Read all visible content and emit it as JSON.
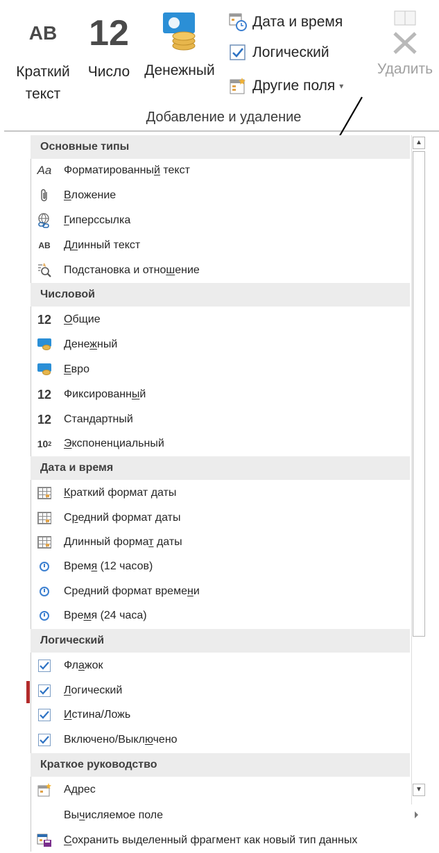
{
  "ribbon": {
    "short_text": {
      "icon_text": "AB",
      "label_line1": "Краткий",
      "label_line2": "текст"
    },
    "number": {
      "icon_text": "12",
      "label": "Число"
    },
    "currency": {
      "label": "Денежный"
    },
    "date_time": {
      "label": "Дата и время"
    },
    "logical": {
      "label": "Логический"
    },
    "more_fields": {
      "label": "Другие поля"
    },
    "delete": {
      "label": "Удалить"
    },
    "group_title": "Добавление и удаление"
  },
  "menu": {
    "sections": [
      {
        "title": "Основные типы"
      },
      {
        "title": "Числовой"
      },
      {
        "title": "Дата и время"
      },
      {
        "title": "Логический"
      },
      {
        "title": "Краткое руководство"
      }
    ],
    "basic": [
      {
        "icon": "formatted-text-icon",
        "icon_text": "Aa",
        "label_pre": "Форматированны",
        "label_u": "й",
        "label_post": " текст"
      },
      {
        "icon": "paperclip-icon",
        "label_pre": "",
        "label_u": "В",
        "label_post": "ложение"
      },
      {
        "icon": "hyperlink-icon",
        "label_pre": "",
        "label_u": "Г",
        "label_post": "иперссылка"
      },
      {
        "icon": "long-text-icon",
        "icon_text": "AB",
        "label_pre": "Д",
        "label_u": "л",
        "label_post": "инный текст"
      },
      {
        "icon": "lookup-icon",
        "label_pre": "Подстановка и отно",
        "label_u": "ш",
        "label_post": "ение"
      }
    ],
    "numeric": [
      {
        "icon": "number-icon",
        "icon_text": "12",
        "label_pre": "",
        "label_u": "О",
        "label_post": "бщие"
      },
      {
        "icon": "currency-icon",
        "label_pre": "Дене",
        "label_u": "ж",
        "label_post": "ный"
      },
      {
        "icon": "euro-icon",
        "label_pre": "",
        "label_u": "Е",
        "label_post": "вро"
      },
      {
        "icon": "number-icon",
        "icon_text": "12",
        "label_pre": "Фиксированн",
        "label_u": "ы",
        "label_post": "й"
      },
      {
        "icon": "number-icon",
        "icon_text": "12",
        "label_pre": "Стан",
        "label_u": "д",
        "label_post": "артный"
      },
      {
        "icon": "scientific-icon",
        "icon_text": "10",
        "icon_sup": "2",
        "label_pre": "",
        "label_u": "Э",
        "label_post": "кспоненциальный"
      }
    ],
    "datetime": [
      {
        "icon": "calendar-icon",
        "label_pre": "",
        "label_u": "К",
        "label_post": "раткий формат даты"
      },
      {
        "icon": "calendar-icon",
        "label_pre": "С",
        "label_u": "р",
        "label_post": "едний формат даты"
      },
      {
        "icon": "calendar-icon",
        "label_pre": "Длинный форма",
        "label_u": "т",
        "label_post": " даты"
      },
      {
        "icon": "clock-icon",
        "label_pre": "Врем",
        "label_u": "я",
        "label_post": " (12 часов)"
      },
      {
        "icon": "clock-icon",
        "label_pre": "Средний формат време",
        "label_u": "н",
        "label_post": "и"
      },
      {
        "icon": "clock-icon",
        "label_pre": "Вре",
        "label_u": "м",
        "label_post": "я (24 часа)"
      }
    ],
    "logical": [
      {
        "icon": "checkbox-icon",
        "label_pre": "Фл",
        "label_u": "а",
        "label_post": "жок"
      },
      {
        "icon": "checkbox-icon",
        "label_pre": "",
        "label_u": "Л",
        "label_post": "огический"
      },
      {
        "icon": "checkbox-icon",
        "label_pre": "",
        "label_u": "И",
        "label_post": "стина/Ложь"
      },
      {
        "icon": "checkbox-icon",
        "label_pre": "Включено/Выкл",
        "label_u": "ю",
        "label_post": "чено"
      }
    ],
    "quickstart": [
      {
        "icon": "address-icon",
        "label_pre": "Адрес",
        "label_u": "",
        "label_post": ""
      }
    ],
    "footer": {
      "calculated": {
        "label_pre": "Вы",
        "label_u": "ч",
        "label_post": "исляемое поле"
      },
      "save_as": {
        "label_pre": "",
        "label_u": "С",
        "label_post": "охранить выделенный фрагмент как новый тип данных"
      }
    }
  },
  "colors": {
    "accent_blue": "#2b8fd6",
    "coin_gold": "#e7b64c",
    "section_bg": "#ececec"
  }
}
